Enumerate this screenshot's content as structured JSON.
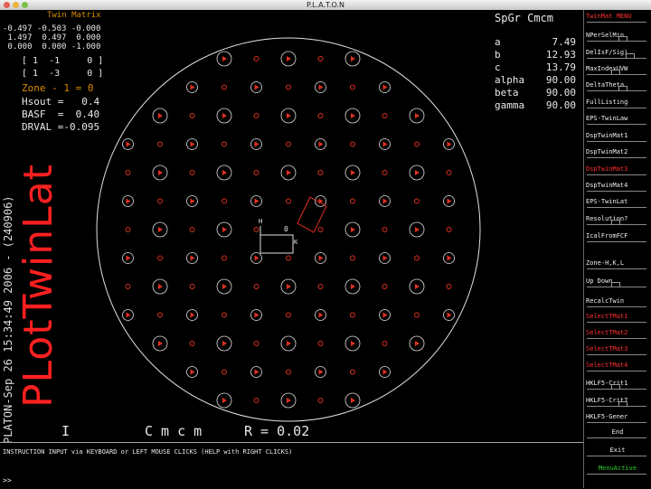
{
  "window": {
    "title": "P.L.A.T.O.N"
  },
  "twin_matrix": {
    "header": "Twin Matrix",
    "rows": [
      "-0.497 -0.503 -0.000",
      " 1.497  0.497  0.000",
      " 0.000  0.000 -1.000"
    ],
    "int_rows": [
      "[ 1  -1     0 ]",
      "[ 1  -3     0 ]"
    ],
    "zone": "Zone - 1 = 0",
    "hsout": "Hsout =   0.4",
    "base": "BASF  =  0.40",
    "drval": "DRVAL =-0.095"
  },
  "cell": {
    "header": "SpGr Cmcm",
    "params": [
      {
        "label": "a",
        "value": "7.49"
      },
      {
        "label": "b",
        "value": "12.93"
      },
      {
        "label": "c",
        "value": "13.79"
      },
      {
        "label": "alpha",
        "value": "90.00"
      },
      {
        "label": "beta",
        "value": "90.00"
      },
      {
        "label": "gamma",
        "value": "90.00"
      }
    ]
  },
  "plot": {
    "big_title": "PLotTwinLat",
    "side_stamp": "PLATON-Sep 26 15:34:49 2006 - (240906)",
    "bottom_left": "I",
    "spacegroup": "C m c m",
    "r_value": "R = 0.02",
    "axis_labels": {
      "h": "H",
      "origin": "0",
      "k": "K"
    }
  },
  "instruction": {
    "text": "INSTRUCTION INPUT via KEYBOARD or LEFT MOUSE CLICKS (HELP with RIGHT CLICKS)",
    "prompt": ">>"
  },
  "menu": {
    "items": [
      {
        "label": "TwinMat MENU",
        "style": "red"
      },
      {
        "label": "NPerSelMin",
        "style": "white"
      },
      {
        "label": "DelIsF/Sig)",
        "style": "white"
      },
      {
        "label": "MaxIndexUVW",
        "style": "white"
      },
      {
        "label": "DeltaTheta",
        "style": "white"
      },
      {
        "label": "FullListing",
        "style": "white"
      },
      {
        "label": "EPS-TwinLaw",
        "style": "white"
      },
      {
        "label": "DspTwinMat1",
        "style": "white"
      },
      {
        "label": "DspTwinMat2",
        "style": "white"
      },
      {
        "label": "DspTwinMat3",
        "style": "red"
      },
      {
        "label": "DspTwinMat4",
        "style": "white"
      },
      {
        "label": "EPS-TwinLat",
        "style": "white"
      },
      {
        "label": "Resolution?",
        "style": "white"
      },
      {
        "label": "IcalFromFCF",
        "style": "white"
      },
      {
        "label": "Zone-H,K,L",
        "style": "white"
      },
      {
        "label": "Up     Down",
        "style": "white"
      },
      {
        "label": "RecalcTwin",
        "style": "white"
      },
      {
        "label": "SelectTMat1",
        "style": "red"
      },
      {
        "label": "SelectTMat2",
        "style": "red"
      },
      {
        "label": "SelectTMat3",
        "style": "red"
      },
      {
        "label": "SelectTMat4",
        "style": "red"
      },
      {
        "label": "HKLF5-Crit1",
        "style": "white"
      },
      {
        "label": "HKLF5-Crit7",
        "style": "white"
      },
      {
        "label": "HKLF5-Gener",
        "style": "white"
      },
      {
        "label": "End",
        "style": "white"
      },
      {
        "label": "Exit",
        "style": "white"
      },
      {
        "label": "MenuActive",
        "style": "green"
      }
    ]
  },
  "colors": {
    "spot": "#e03020",
    "ring": "#e0e0e0",
    "title": "#ff2020"
  }
}
